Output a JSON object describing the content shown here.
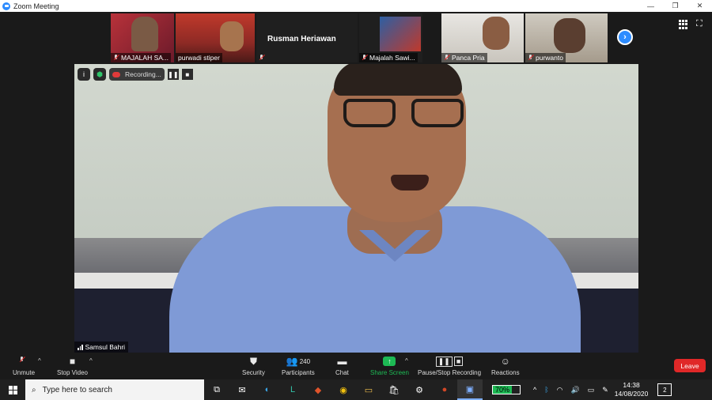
{
  "window": {
    "title": "Zoom Meeting",
    "minimize": "—",
    "restore": "❐",
    "close": "✕"
  },
  "strip": {
    "thumbs": [
      {
        "name": "MAJALAH SA...",
        "muted": true
      },
      {
        "name": "purwadi stiper",
        "muted": false
      },
      {
        "name": "Rusman Heriawan",
        "muted": true,
        "video": false
      },
      {
        "name": "Majalah Sawi...",
        "muted": true
      },
      {
        "name": "Panca Pria",
        "muted": true
      },
      {
        "name": "purwanto",
        "muted": true
      }
    ],
    "next_icon": "›"
  },
  "main": {
    "speaker": "Samsul Bahri",
    "recording_label": "Recording...",
    "pause_icon": "❚❚",
    "stop_icon": "■",
    "info_icon": "i"
  },
  "toolbar": {
    "unmute": "Unmute",
    "stop_video": "Stop Video",
    "security": "Security",
    "participants": "Participants",
    "participants_count": "240",
    "chat": "Chat",
    "share_screen": "Share Screen",
    "pause_stop_recording": "Pause/Stop Recording",
    "reactions": "Reactions",
    "leave": "Leave"
  },
  "taskbar": {
    "search_placeholder": "Type here to search",
    "battery_percent": "70%",
    "time": "14:38",
    "date": "14/08/2020",
    "notifications": "2"
  },
  "colors": {
    "accent": "#2d8cff",
    "share": "#1db954",
    "leave": "#e02828"
  }
}
